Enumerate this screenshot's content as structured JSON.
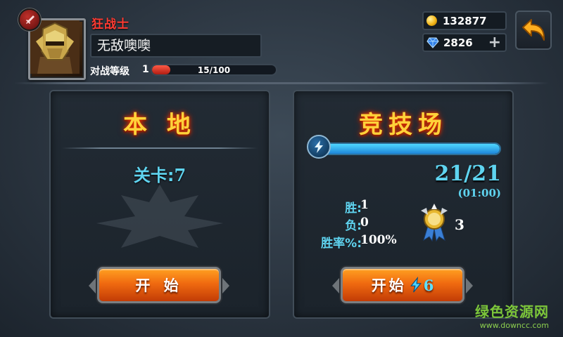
{
  "player": {
    "class_name": "狂战士",
    "name": "无敌噢噢",
    "level_label": "对战等级",
    "level": "1",
    "exp_text": "15/100",
    "exp_progress": 0.15
  },
  "currency": {
    "gold": "132877",
    "gems": "2826",
    "add_symbol": "+"
  },
  "icons": {
    "class_badge": "sword-badge-icon",
    "back": "back-arrow-icon",
    "coin": "gold-coin-icon",
    "gem": "blue-gem-icon",
    "energy": "lightning-icon",
    "medal": "rank-medal-icon"
  },
  "local": {
    "title": "本 地",
    "stage_label": "关卡:",
    "stage_value": "7",
    "start_label": "开 始"
  },
  "arena": {
    "title": "竞技场",
    "energy_progress": 1.0,
    "energy_count": "21/21",
    "energy_timer": "(01:00)",
    "stats": [
      {
        "label": "胜:",
        "value": "1"
      },
      {
        "label": "负:",
        "value": "0"
      },
      {
        "label": "胜率%:",
        "value": "100%"
      }
    ],
    "rank": "3",
    "start_label": "开始",
    "start_cost": "6"
  },
  "watermark": {
    "line1": "绿色资源网",
    "line2": "www.downcc.com"
  },
  "colors": {
    "accent_cyan": "#5fd4f0",
    "title_gold": "#ffd23a",
    "class_red": "#ff3b32",
    "button_orange": "#f06a10"
  }
}
